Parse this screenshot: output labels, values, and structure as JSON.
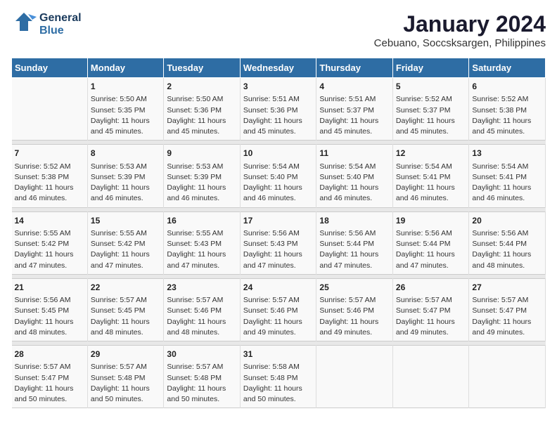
{
  "header": {
    "logo_general": "General",
    "logo_blue": "Blue",
    "title": "January 2024",
    "subtitle": "Cebuano, Soccsksargen, Philippines"
  },
  "calendar": {
    "days_of_week": [
      "Sunday",
      "Monday",
      "Tuesday",
      "Wednesday",
      "Thursday",
      "Friday",
      "Saturday"
    ],
    "weeks": [
      [
        {
          "num": "",
          "info": ""
        },
        {
          "num": "1",
          "info": "Sunrise: 5:50 AM\nSunset: 5:35 PM\nDaylight: 11 hours\nand 45 minutes."
        },
        {
          "num": "2",
          "info": "Sunrise: 5:50 AM\nSunset: 5:36 PM\nDaylight: 11 hours\nand 45 minutes."
        },
        {
          "num": "3",
          "info": "Sunrise: 5:51 AM\nSunset: 5:36 PM\nDaylight: 11 hours\nand 45 minutes."
        },
        {
          "num": "4",
          "info": "Sunrise: 5:51 AM\nSunset: 5:37 PM\nDaylight: 11 hours\nand 45 minutes."
        },
        {
          "num": "5",
          "info": "Sunrise: 5:52 AM\nSunset: 5:37 PM\nDaylight: 11 hours\nand 45 minutes."
        },
        {
          "num": "6",
          "info": "Sunrise: 5:52 AM\nSunset: 5:38 PM\nDaylight: 11 hours\nand 45 minutes."
        }
      ],
      [
        {
          "num": "7",
          "info": "Sunrise: 5:52 AM\nSunset: 5:38 PM\nDaylight: 11 hours\nand 46 minutes."
        },
        {
          "num": "8",
          "info": "Sunrise: 5:53 AM\nSunset: 5:39 PM\nDaylight: 11 hours\nand 46 minutes."
        },
        {
          "num": "9",
          "info": "Sunrise: 5:53 AM\nSunset: 5:39 PM\nDaylight: 11 hours\nand 46 minutes."
        },
        {
          "num": "10",
          "info": "Sunrise: 5:54 AM\nSunset: 5:40 PM\nDaylight: 11 hours\nand 46 minutes."
        },
        {
          "num": "11",
          "info": "Sunrise: 5:54 AM\nSunset: 5:40 PM\nDaylight: 11 hours\nand 46 minutes."
        },
        {
          "num": "12",
          "info": "Sunrise: 5:54 AM\nSunset: 5:41 PM\nDaylight: 11 hours\nand 46 minutes."
        },
        {
          "num": "13",
          "info": "Sunrise: 5:54 AM\nSunset: 5:41 PM\nDaylight: 11 hours\nand 46 minutes."
        }
      ],
      [
        {
          "num": "14",
          "info": "Sunrise: 5:55 AM\nSunset: 5:42 PM\nDaylight: 11 hours\nand 47 minutes."
        },
        {
          "num": "15",
          "info": "Sunrise: 5:55 AM\nSunset: 5:42 PM\nDaylight: 11 hours\nand 47 minutes."
        },
        {
          "num": "16",
          "info": "Sunrise: 5:55 AM\nSunset: 5:43 PM\nDaylight: 11 hours\nand 47 minutes."
        },
        {
          "num": "17",
          "info": "Sunrise: 5:56 AM\nSunset: 5:43 PM\nDaylight: 11 hours\nand 47 minutes."
        },
        {
          "num": "18",
          "info": "Sunrise: 5:56 AM\nSunset: 5:44 PM\nDaylight: 11 hours\nand 47 minutes."
        },
        {
          "num": "19",
          "info": "Sunrise: 5:56 AM\nSunset: 5:44 PM\nDaylight: 11 hours\nand 47 minutes."
        },
        {
          "num": "20",
          "info": "Sunrise: 5:56 AM\nSunset: 5:44 PM\nDaylight: 11 hours\nand 48 minutes."
        }
      ],
      [
        {
          "num": "21",
          "info": "Sunrise: 5:56 AM\nSunset: 5:45 PM\nDaylight: 11 hours\nand 48 minutes."
        },
        {
          "num": "22",
          "info": "Sunrise: 5:57 AM\nSunset: 5:45 PM\nDaylight: 11 hours\nand 48 minutes."
        },
        {
          "num": "23",
          "info": "Sunrise: 5:57 AM\nSunset: 5:46 PM\nDaylight: 11 hours\nand 48 minutes."
        },
        {
          "num": "24",
          "info": "Sunrise: 5:57 AM\nSunset: 5:46 PM\nDaylight: 11 hours\nand 49 minutes."
        },
        {
          "num": "25",
          "info": "Sunrise: 5:57 AM\nSunset: 5:46 PM\nDaylight: 11 hours\nand 49 minutes."
        },
        {
          "num": "26",
          "info": "Sunrise: 5:57 AM\nSunset: 5:47 PM\nDaylight: 11 hours\nand 49 minutes."
        },
        {
          "num": "27",
          "info": "Sunrise: 5:57 AM\nSunset: 5:47 PM\nDaylight: 11 hours\nand 49 minutes."
        }
      ],
      [
        {
          "num": "28",
          "info": "Sunrise: 5:57 AM\nSunset: 5:47 PM\nDaylight: 11 hours\nand 50 minutes."
        },
        {
          "num": "29",
          "info": "Sunrise: 5:57 AM\nSunset: 5:48 PM\nDaylight: 11 hours\nand 50 minutes."
        },
        {
          "num": "30",
          "info": "Sunrise: 5:57 AM\nSunset: 5:48 PM\nDaylight: 11 hours\nand 50 minutes."
        },
        {
          "num": "31",
          "info": "Sunrise: 5:58 AM\nSunset: 5:48 PM\nDaylight: 11 hours\nand 50 minutes."
        },
        {
          "num": "",
          "info": ""
        },
        {
          "num": "",
          "info": ""
        },
        {
          "num": "",
          "info": ""
        }
      ]
    ]
  }
}
